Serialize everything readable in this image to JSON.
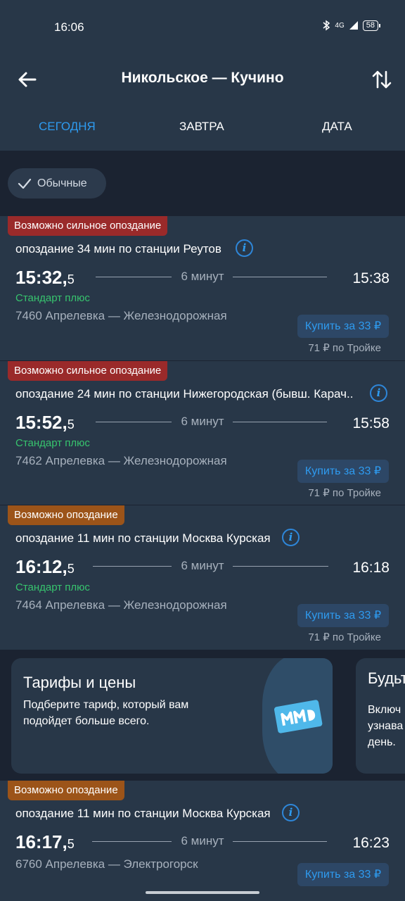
{
  "status": {
    "time": "16:06",
    "network": "4G",
    "battery": "58"
  },
  "header": {
    "title": "Никольское — Кучино"
  },
  "tabs": [
    {
      "label": "СЕГОДНЯ",
      "active": true
    },
    {
      "label": "ЗАВТРА",
      "active": false
    },
    {
      "label": "ДАТА",
      "active": false
    }
  ],
  "filter": {
    "chip_label": "Обычные"
  },
  "trains": [
    {
      "badge": "Возможно сильное опоздание",
      "badge_color": "#9a2a2a",
      "delay": "опоздание 34 мин по станции Реутов",
      "dep_hm": "15:32",
      "dep_sec": "5",
      "duration": "6 минут",
      "arr": "15:38",
      "tariff": "Стандарт плюс",
      "route": "7460 Апрелевка — Железнодорожная",
      "buy": "Купить за 33 ₽",
      "troika": "71 ₽ по Тройке"
    },
    {
      "badge": "Возможно сильное опоздание",
      "badge_color": "#9a2a2a",
      "delay": "опоздание 24 мин по станции Нижегородская (бывш. Карач..",
      "dep_hm": "15:52",
      "dep_sec": "5",
      "duration": "6 минут",
      "arr": "15:58",
      "tariff": "Стандарт плюс",
      "route": "7462 Апрелевка — Железнодорожная",
      "buy": "Купить за 33 ₽",
      "troika": "71 ₽ по Тройке"
    },
    {
      "badge": "Возможно опоздание",
      "badge_color": "#9c5419",
      "delay": "опоздание 11 мин по станции Москва Курская",
      "dep_hm": "16:12",
      "dep_sec": "5",
      "duration": "6 минут",
      "arr": "16:18",
      "tariff": "Стандарт плюс",
      "route": "7464 Апрелевка — Железнодорожная",
      "buy": "Купить за 33 ₽",
      "troika": "71 ₽ по Тройке"
    },
    {
      "badge": "Возможно опоздание",
      "badge_color": "#9c5419",
      "delay": "опоздание 11 мин по станции Москва Курская",
      "dep_hm": "16:17",
      "dep_sec": "5",
      "duration": "6 минут",
      "arr": "16:23",
      "tariff": "",
      "route": "6760 Апрелевка — Электрогорск",
      "buy": "Купить за 33 ₽",
      "troika": ""
    }
  ],
  "promo": {
    "title": "Тарифы и цены",
    "text": "Подберите тариф, который вам подойдет больше всего.",
    "next_title": "Будьт",
    "next_text_1": "Включ",
    "next_text_2": "узнава",
    "next_text_3": "день."
  }
}
